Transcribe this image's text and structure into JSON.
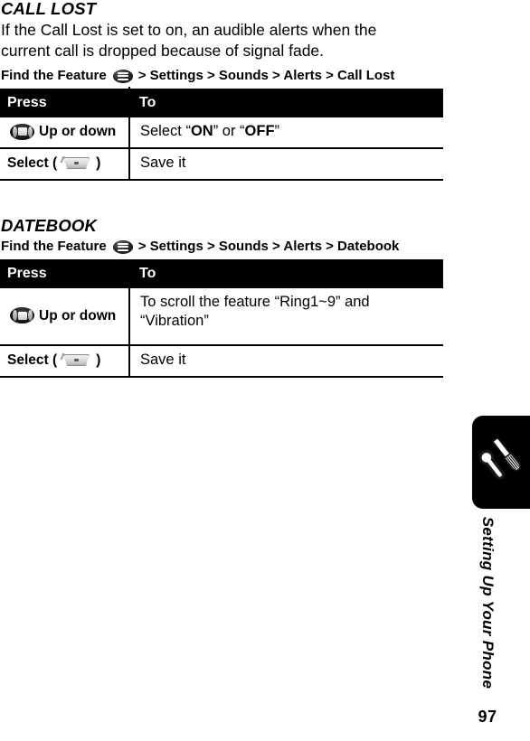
{
  "sections": [
    {
      "title": "CALL LOST",
      "body": "If the Call Lost is set to on, an audible alerts when the current call is dropped because of signal fade.",
      "find_feature": {
        "label": "Find the Feature",
        "icon": "menu-icon",
        "path": "> Settings > Sounds > Alerts > Call Lost"
      },
      "table": {
        "headers": [
          "Press",
          "To"
        ],
        "rows": [
          {
            "press_icon": "navigation-key-icon",
            "press_label": "Up or down",
            "press_prefix": "",
            "press_suffix": "",
            "to": "Select “ON” or “OFF”",
            "to_parts": [
              {
                "text": "Select “",
                "bold": false
              },
              {
                "text": "ON",
                "bold": true
              },
              {
                "text": "” or “",
                "bold": false
              },
              {
                "text": "OFF",
                "bold": true
              },
              {
                "text": "”",
                "bold": false
              }
            ]
          },
          {
            "press_icon": "soft-key-icon",
            "press_label": "",
            "press_prefix": "Select (",
            "press_suffix": ")",
            "to": "Save it",
            "to_parts": [
              {
                "text": "Save it",
                "bold": false
              }
            ]
          }
        ]
      }
    },
    {
      "title": "DATEBOOK",
      "body": "",
      "find_feature": {
        "label": "Find the Feature",
        "icon": "menu-icon",
        "path": "> Settings > Sounds > Alerts > Datebook"
      },
      "table": {
        "headers": [
          "Press",
          "To"
        ],
        "rows": [
          {
            "press_icon": "navigation-key-icon",
            "press_label": "Up or down",
            "press_prefix": "",
            "press_suffix": "",
            "to": "To scroll the feature “Ring1~9” and “Vibration”",
            "to_parts": [
              {
                "text": "To scroll the feature “Ring1~9” and “Vibration”",
                "bold": false
              }
            ]
          },
          {
            "press_icon": "soft-key-icon",
            "press_label": "",
            "press_prefix": "Select (",
            "press_suffix": ")",
            "to": "Save it",
            "to_parts": [
              {
                "text": "Save it",
                "bold": false
              }
            ]
          }
        ]
      }
    }
  ],
  "sidebar": {
    "chapter_icon": "wrench-screwdriver-icon",
    "chapter_label": "Setting Up Your Phone",
    "page_number": "97"
  },
  "colors": {
    "header_background": "#000000",
    "header_text": "#ffffff",
    "page_background": "#ffffff",
    "body_text": "#000000"
  }
}
